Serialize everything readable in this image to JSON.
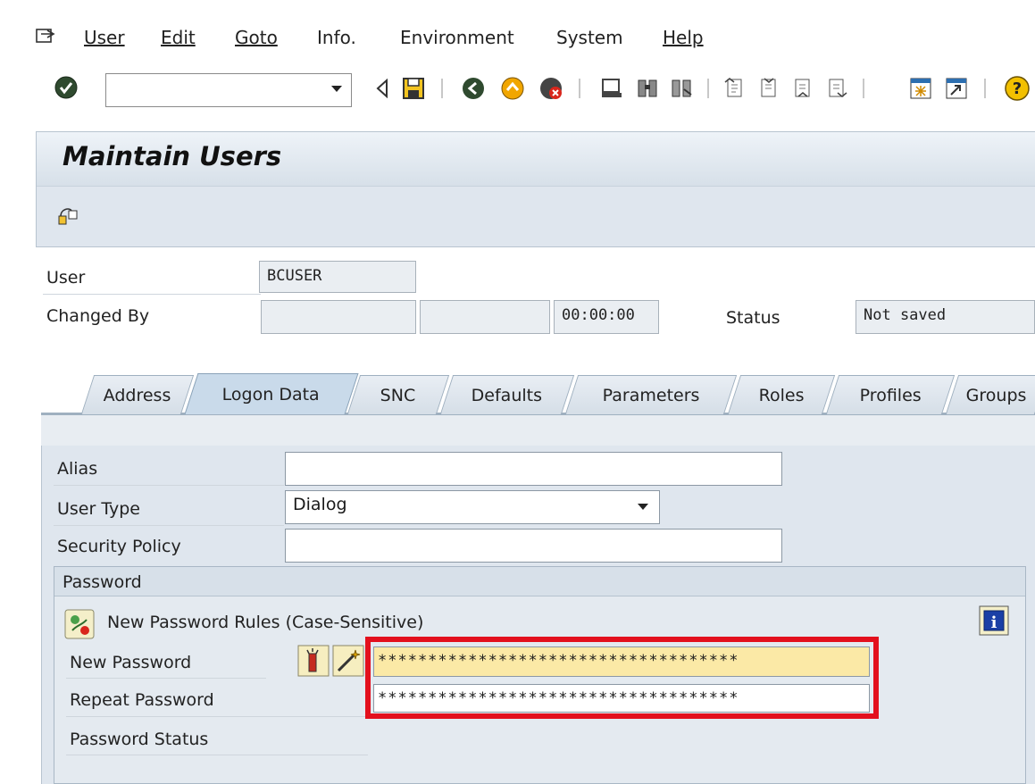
{
  "menu": {
    "user": "User",
    "edit": "Edit",
    "goto": "Goto",
    "info": "Info.",
    "environment": "Environment",
    "system": "System",
    "help": "Help"
  },
  "toolbar": {
    "command_value": ""
  },
  "title": "Maintain Users",
  "header": {
    "user_label": "User",
    "user_value": "BCUSER",
    "changed_by_label": "Changed By",
    "changed_by_value": "",
    "changed_date_value": "",
    "changed_time_value": "00:00:00",
    "status_label": "Status",
    "status_value": "Not saved"
  },
  "tabs": [
    {
      "label": "Address"
    },
    {
      "label": "Logon Data"
    },
    {
      "label": "SNC"
    },
    {
      "label": "Defaults"
    },
    {
      "label": "Parameters"
    },
    {
      "label": "Roles"
    },
    {
      "label": "Profiles"
    },
    {
      "label": "Groups"
    }
  ],
  "logon": {
    "alias_label": "Alias",
    "alias_value": "",
    "user_type_label": "User Type",
    "user_type_value": "Dialog",
    "security_policy_label": "Security Policy",
    "security_policy_value": ""
  },
  "password": {
    "group_title": "Password",
    "rules_text": "New Password Rules (Case-Sensitive)",
    "new_label": "New Password",
    "new_value": "************************************",
    "repeat_label": "Repeat Password",
    "repeat_value": "************************************",
    "status_label": "Password Status"
  },
  "colors": {
    "highlight": "#e3101d",
    "panel_bg": "#dfe6ee",
    "password_field_bg": "#fbe9a6"
  }
}
